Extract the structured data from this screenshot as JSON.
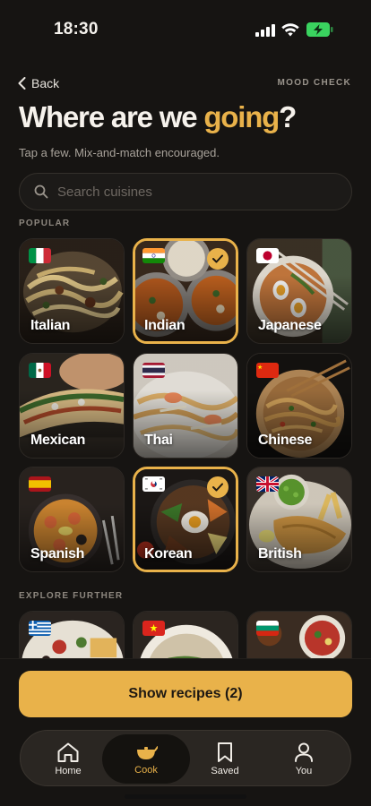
{
  "status_bar": {
    "time": "18:30",
    "battery_color": "#3ad35f"
  },
  "header": {
    "back_label": "Back",
    "mood_check": "MOOD CHECK",
    "title_start": "Where are we ",
    "title_accent": "going",
    "title_end": "?",
    "subtitle": "Tap a few. Mix-and-match encouraged."
  },
  "search": {
    "placeholder": "Search cuisines",
    "value": ""
  },
  "sections": {
    "popular": "POPULAR",
    "explore": "EXPLORE FURTHER"
  },
  "cuisines": {
    "italian": {
      "label": "Italian",
      "selected": false,
      "flag": "italy-flag"
    },
    "indian": {
      "label": "Indian",
      "selected": true,
      "flag": "india-flag"
    },
    "japanese": {
      "label": "Japanese",
      "selected": false,
      "flag": "japan-flag"
    },
    "mexican": {
      "label": "Mexican",
      "selected": false,
      "flag": "mexico-flag"
    },
    "thai": {
      "label": "Thai",
      "selected": false,
      "flag": "thailand-flag"
    },
    "chinese": {
      "label": "Chinese",
      "selected": false,
      "flag": "china-flag"
    },
    "spanish": {
      "label": "Spanish",
      "selected": false,
      "flag": "spain-flag"
    },
    "korean": {
      "label": "Korean",
      "selected": true,
      "flag": "south-korea-flag"
    },
    "british": {
      "label": "British",
      "selected": false,
      "flag": "uk-flag"
    }
  },
  "explore": [
    {
      "flag": "greece-flag"
    },
    {
      "flag": "vietnam-flag"
    },
    {
      "flag": "bulgaria-flag"
    }
  ],
  "cta": {
    "label": "Show recipes (2)"
  },
  "tabs": [
    {
      "label": "Home",
      "icon": "home-icon",
      "active": false
    },
    {
      "label": "Cook",
      "icon": "pot-icon",
      "active": true
    },
    {
      "label": "Saved",
      "icon": "bookmark-icon",
      "active": false
    },
    {
      "label": "You",
      "icon": "person-icon",
      "active": false
    }
  ],
  "colors": {
    "accent": "#e9b24a",
    "background": "#161412",
    "surface": "#2a2622"
  }
}
